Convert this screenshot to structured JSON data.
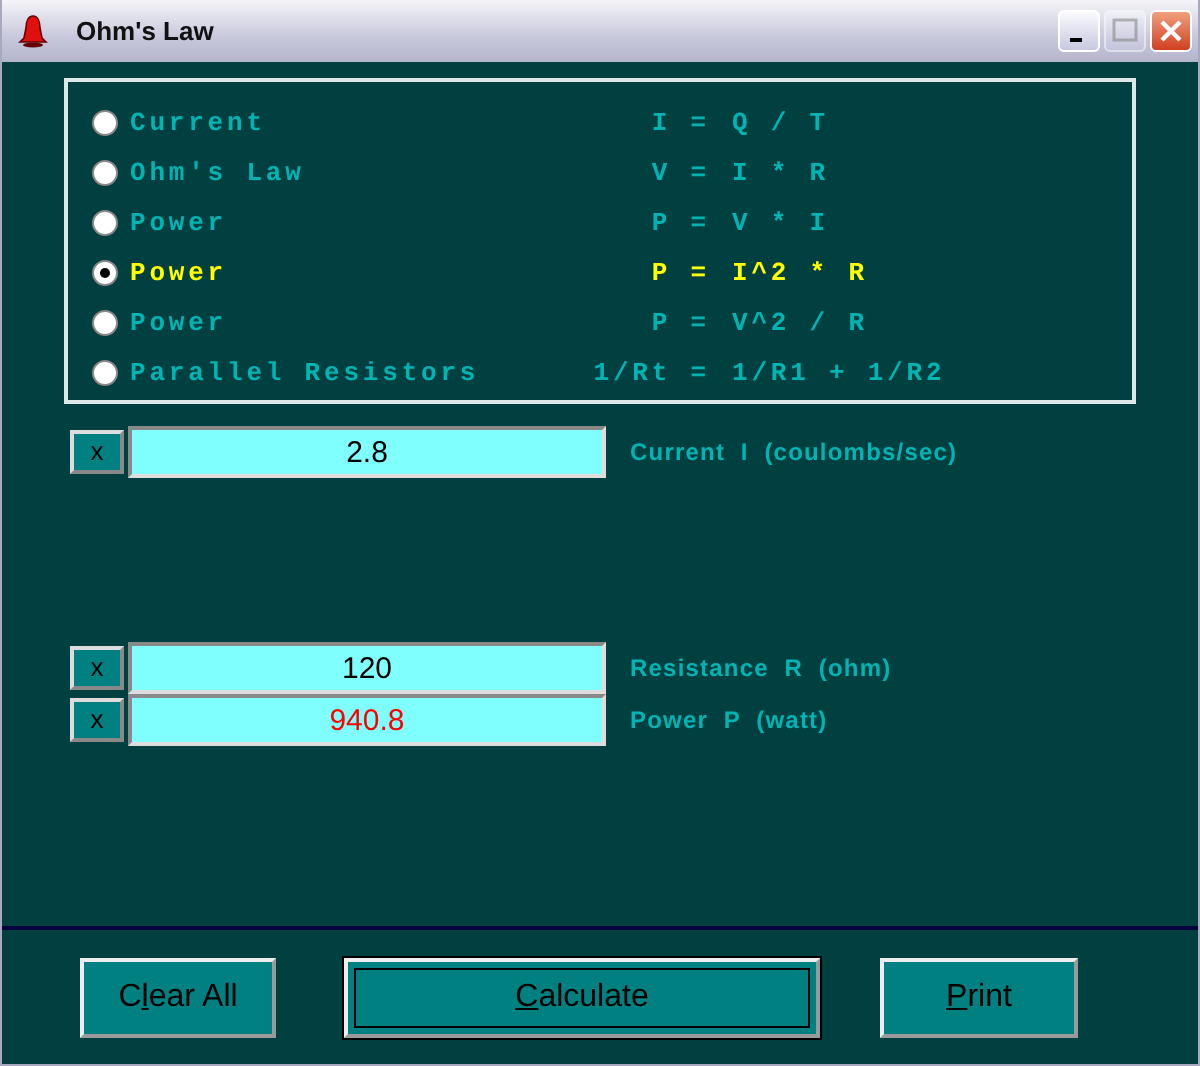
{
  "window": {
    "title": "Ohm's Law",
    "controls": [
      {
        "kind": "minimize",
        "disabled": false
      },
      {
        "kind": "maximize",
        "disabled": true
      },
      {
        "kind": "close",
        "disabled": false
      }
    ]
  },
  "formulas": [
    {
      "name": "Current",
      "lhs": "I =",
      "rhs": "Q / T",
      "selected": false
    },
    {
      "name": "Ohm's Law",
      "lhs": "V =",
      "rhs": "I * R",
      "selected": false
    },
    {
      "name": "Power",
      "lhs": "P =",
      "rhs": "V * I",
      "selected": false
    },
    {
      "name": "Power",
      "lhs": "P =",
      "rhs": "I^2 * R",
      "selected": true
    },
    {
      "name": "Power",
      "lhs": "P =",
      "rhs": "V^2 / R",
      "selected": false
    },
    {
      "name": "Parallel Resistors",
      "lhs": "1/Rt =",
      "rhs": "1/R1 + 1/R2",
      "selected": false
    }
  ],
  "fields": [
    {
      "clear": "x",
      "value": "2.8",
      "label": "Current  I  (coulombs/sec)",
      "result": false
    },
    {
      "clear": "x",
      "value": "120",
      "label": "Resistance  R  (ohm)",
      "result": false
    },
    {
      "clear": "x",
      "value": "940.8",
      "label": "Power  P  (watt)",
      "result": true
    }
  ],
  "buttons": [
    {
      "before": "C",
      "key": "l",
      "after": "ear All",
      "default": false
    },
    {
      "key": "C",
      "after": "alculate",
      "default": true
    },
    {
      "key": "P",
      "after": "rint",
      "default": false
    }
  ]
}
